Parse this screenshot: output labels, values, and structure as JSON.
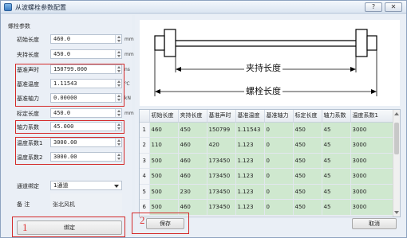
{
  "window": {
    "title": "从波螺栓参数配置",
    "help_label": "?",
    "close_label": "✕"
  },
  "left": {
    "group_title": "螺栓参数",
    "fields": [
      {
        "label": "初始长度",
        "value": "460.0",
        "unit": "mm"
      },
      {
        "label": "夹持长度",
        "value": "450.0",
        "unit": "mm"
      },
      {
        "label": "基准声时",
        "value": "150799.000",
        "unit": "ns"
      },
      {
        "label": "基准温度",
        "value": "1.11543",
        "unit": "℃"
      },
      {
        "label": "基准轴力",
        "value": "0.00000",
        "unit": "kN"
      },
      {
        "label": "标定长度",
        "value": "450.0",
        "unit": "mm"
      },
      {
        "label": "轴力系数",
        "value": "45.000",
        "unit": ""
      },
      {
        "label": "温度系数1",
        "value": "3000.00",
        "unit": ""
      },
      {
        "label": "温度系数2",
        "value": "3000.00",
        "unit": ""
      }
    ],
    "channel": {
      "label": "通道绑定",
      "value": "1通道"
    },
    "remark": {
      "label": "备  注",
      "value": "张北风机"
    },
    "bind_button": "绑定",
    "step1": "1"
  },
  "diagram": {
    "clamp_label": "夹持长度",
    "bolt_label": "螺栓长度"
  },
  "table": {
    "headers": [
      "",
      "初始长度",
      "夹持长度",
      "基准声时",
      "基准温度",
      "基准轴力",
      "标定长度",
      "轴力系数",
      "温度系数1"
    ],
    "rows": [
      [
        "1",
        "460",
        "450",
        "150799",
        "1.11543",
        "0",
        "450",
        "45",
        "3000"
      ],
      [
        "2",
        "110",
        "460",
        "420",
        "1.123",
        "0",
        "450",
        "45",
        "3000"
      ],
      [
        "3",
        "500",
        "460",
        "173450",
        "1.123",
        "0",
        "450",
        "45",
        "3000"
      ],
      [
        "4",
        "500",
        "460",
        "173450",
        "1.123",
        "0",
        "450",
        "45",
        "3000"
      ],
      [
        "5",
        "500",
        "230",
        "173450",
        "1.123",
        "0",
        "450",
        "45",
        "3000"
      ],
      [
        "6",
        "500",
        "460",
        "173450",
        "1.123",
        "0",
        "450",
        "45",
        "3000"
      ]
    ]
  },
  "right": {
    "save_button": "保存",
    "cancel_button": "取消",
    "step2": "2"
  },
  "colors": {
    "highlight": "#d42a2a",
    "row_fill": "#cfe8cf"
  }
}
